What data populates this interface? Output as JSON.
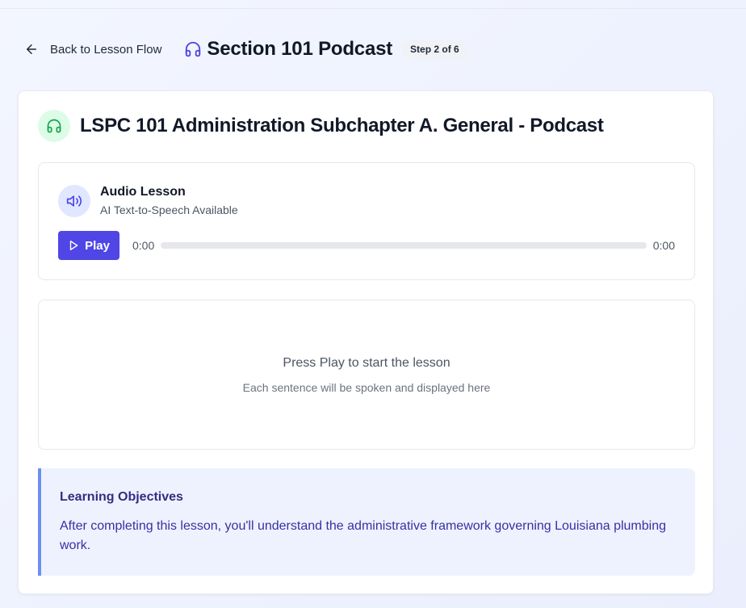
{
  "header": {
    "back_label": "Back to Lesson Flow",
    "title": "Section 101 Podcast",
    "step_badge": "Step 2 of 6"
  },
  "lesson": {
    "title": "LSPC 101 Administration Subchapter A. General - Podcast",
    "icon": "headphones-icon"
  },
  "audio": {
    "title": "Audio Lesson",
    "subtitle": "AI Text-to-Speech Available",
    "play_label": "Play",
    "current_time": "0:00",
    "duration": "0:00",
    "progress": 0
  },
  "transcript": {
    "prompt": "Press Play to start the lesson",
    "hint": "Each sentence will be spoken and displayed here"
  },
  "objectives": {
    "title": "Learning Objectives",
    "text": "After completing this lesson, you'll understand the administrative framework governing Louisiana plumbing work."
  },
  "colors": {
    "accent": "#4f46e5",
    "lesson_icon_bg": "#dcfce7",
    "lesson_icon": "#16a34a",
    "objectives_bg": "#eef2ff",
    "objectives_border": "#6d8ff0"
  }
}
